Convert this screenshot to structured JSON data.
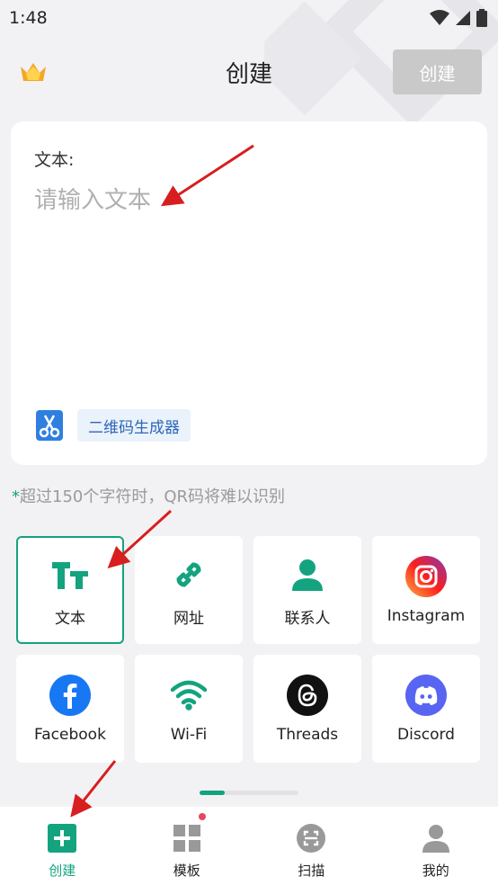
{
  "status_bar": {
    "time": "1:48"
  },
  "header": {
    "title": "创建",
    "create_button": "创建"
  },
  "text_card": {
    "label": "文本:",
    "placeholder": "请输入文本",
    "generator_tag": "二维码生成器"
  },
  "warning": {
    "star": "*",
    "text": "超过150个字符时，QR码将难以识别"
  },
  "types": [
    {
      "label": "文本",
      "icon": "text-tt-icon"
    },
    {
      "label": "网址",
      "icon": "link-icon"
    },
    {
      "label": "联系人",
      "icon": "contact-person-icon"
    },
    {
      "label": "Instagram",
      "icon": "instagram-icon"
    },
    {
      "label": "Facebook",
      "icon": "facebook-icon"
    },
    {
      "label": "Wi-Fi",
      "icon": "wifi-icon"
    },
    {
      "label": "Threads",
      "icon": "threads-icon"
    },
    {
      "label": "Discord",
      "icon": "discord-icon"
    }
  ],
  "bottom_nav": [
    {
      "label": "创建",
      "icon": "plus-square-icon"
    },
    {
      "label": "模板",
      "icon": "template-grid-icon"
    },
    {
      "label": "扫描",
      "icon": "scan-icon"
    },
    {
      "label": "我的",
      "icon": "profile-icon"
    }
  ],
  "colors": {
    "accent": "#14a37f",
    "disabled_button": "#c9c9c9",
    "tag_text": "#2f66b8",
    "annotation_arrow": "#d81e1e"
  }
}
